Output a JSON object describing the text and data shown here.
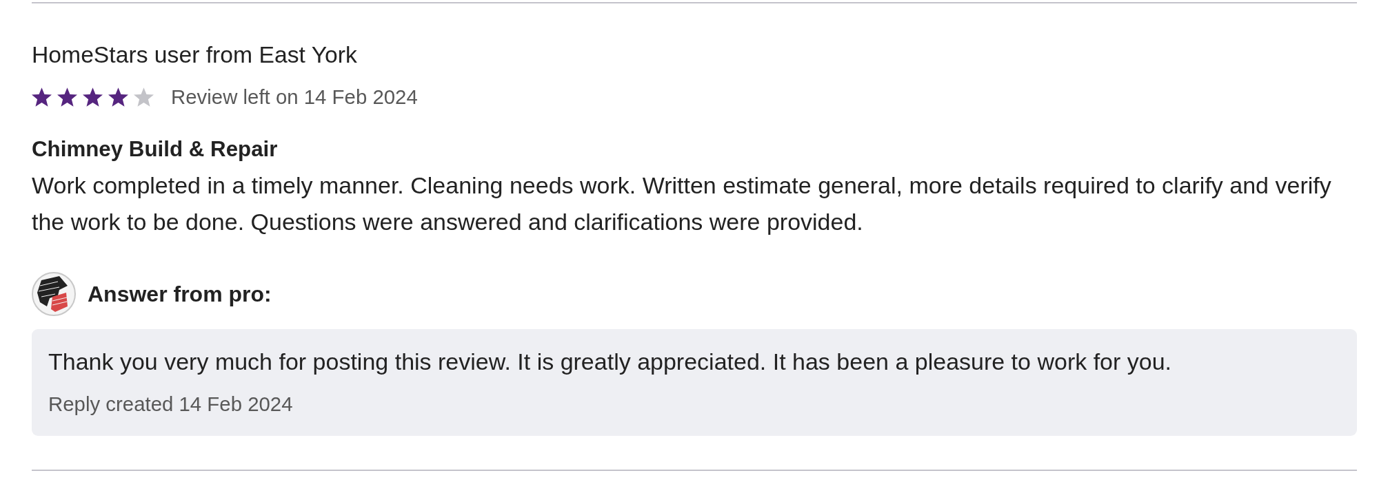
{
  "review": {
    "author": "HomeStars user from East York",
    "stars": 4,
    "date_text": "Review left on 14 Feb 2024",
    "title": "Chimney Build & Repair",
    "body": "Work completed in a timely manner. Cleaning needs work. Written estimate general, more details required to clarify and verify the work to be done. Questions were answered and clarifications were provided."
  },
  "pro_answer": {
    "heading": "Answer from pro:",
    "reply": "Thank you very much for posting this review. It is greatly appreciated. It has been a pleasure to work for you.",
    "created": "Reply created 14 Feb 2024"
  }
}
